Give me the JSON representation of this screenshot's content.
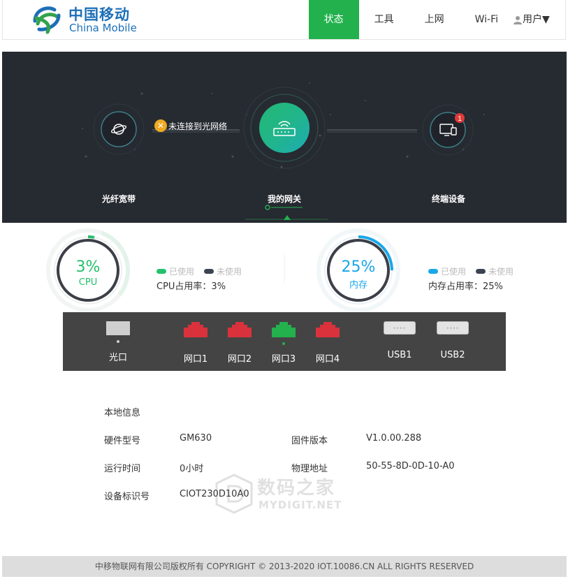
{
  "brand": {
    "name_cn": "中国移动",
    "name_en": "China Mobile",
    "color": "#1d6fb8"
  },
  "nav": {
    "items": [
      {
        "label": "状态",
        "active": true
      },
      {
        "label": "工具",
        "active": false
      },
      {
        "label": "上网",
        "active": false
      },
      {
        "label": "Wi-Fi",
        "active": false
      }
    ],
    "user_label": "用户▼",
    "accent": "#23b14d"
  },
  "topology": {
    "fiber": {
      "label": "光纤宽带",
      "icon": "globe-icon"
    },
    "gateway": {
      "label": "我的网关",
      "icon": "router-icon"
    },
    "terminal": {
      "label": "终端设备",
      "icon": "monitor-icon",
      "badge": "1"
    },
    "link_status": "未连接到光网络"
  },
  "cpu": {
    "value": "3%",
    "label": "CPU",
    "percent": 3,
    "used": "已使用",
    "unused": "未使用",
    "usage_text": "CPU占用率：3%",
    "color": "#23c16b"
  },
  "memory": {
    "value": "25%",
    "label": "内存",
    "percent": 25,
    "used": "已使用",
    "unused": "未使用",
    "usage_text": "内存占用率：25%",
    "color": "#19a7e8"
  },
  "ports": [
    {
      "name": "光口",
      "type": "optical",
      "status_dot": true
    },
    {
      "name": "网口1",
      "type": "lan",
      "color": "#d9323c",
      "status_dot": false
    },
    {
      "name": "网口2",
      "type": "lan",
      "color": "#d9323c",
      "status_dot": false
    },
    {
      "name": "网口3",
      "type": "lan",
      "color": "#23b14d",
      "status_dot": true
    },
    {
      "name": "网口4",
      "type": "lan",
      "color": "#d9323c",
      "status_dot": false
    },
    {
      "name": "USB1",
      "type": "usb",
      "status_dot": false
    },
    {
      "name": "USB2",
      "type": "usb",
      "status_dot": false
    }
  ],
  "local_info": {
    "title": "本地信息",
    "hw_model_label": "硬件型号",
    "hw_model": "GM630",
    "fw_label": "固件版本",
    "fw": "V1.0.00.288",
    "uptime_label": "运行时间",
    "uptime": "0小时",
    "mac_label": "物理地址",
    "mac": "50-55-8D-0D-10-A0",
    "device_id_label": "设备标识号",
    "device_id": "CIOT230D10A0"
  },
  "watermark": {
    "cn": "数码之家",
    "en": "MYDIGIT.NET"
  },
  "footer": "中移物联网有限公司版权所有 COPYRIGHT © 2013-2020 IOT.10086.CN ALL RIGHTS RESERVED"
}
